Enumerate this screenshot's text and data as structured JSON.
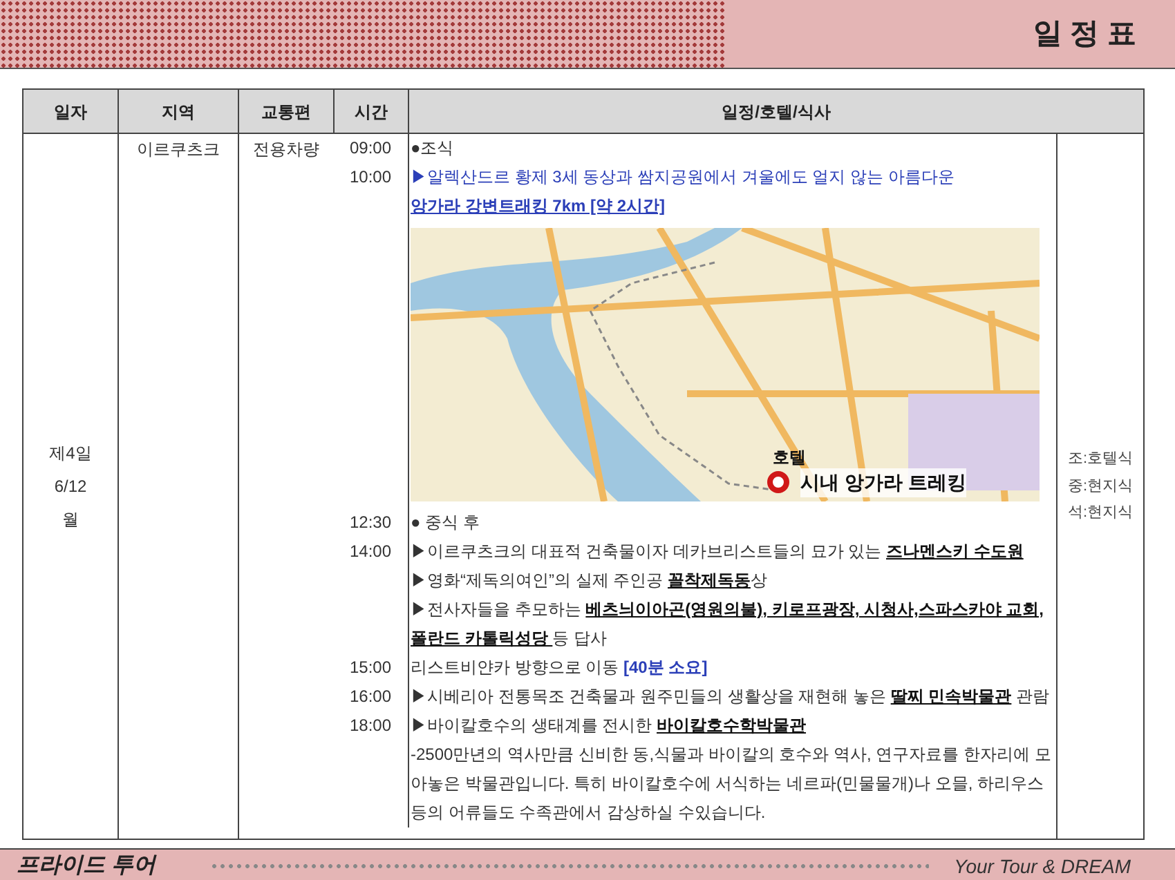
{
  "header": {
    "title": "일 정 표"
  },
  "table": {
    "columns": [
      "일자",
      "지역",
      "교통편",
      "시간",
      "일정/호텔/식사"
    ],
    "day": [
      "제4일",
      "6/12",
      "월"
    ],
    "region": "이르쿠츠크",
    "transport": "전용차량",
    "schedule": [
      {
        "kind": "text",
        "time": "09:00",
        "segments": [
          {
            "kind": "plain",
            "text": "●조식"
          }
        ]
      },
      {
        "kind": "text",
        "time": "10:00",
        "segments": [
          {
            "kind": "blue",
            "text": "▶알렉산드르 황제 3세 동상과 쌈지공원에서 겨울에도 얼지 않는 아름다운"
          }
        ]
      },
      {
        "kind": "text",
        "segments": [
          {
            "kind": "blue_link",
            "text": "앙가라 강변트래킹 7km [약 2시간]"
          }
        ]
      },
      {
        "kind": "map",
        "labels": [
          "호텔",
          "시내 앙가라 트레킹"
        ]
      },
      {
        "kind": "text",
        "time": "12:30",
        "segments": [
          {
            "kind": "plain",
            "text": "● 중식 후"
          }
        ]
      },
      {
        "kind": "text",
        "time": "14:00",
        "segments": [
          {
            "kind": "plain",
            "text": "▶이르쿠츠크의 대표적 건축물이자 데카브리스트들의 묘가 있는 "
          },
          {
            "kind": "highlight",
            "text": "즈나멘스키 수도원"
          }
        ]
      },
      {
        "kind": "text",
        "segments": [
          {
            "kind": "plain",
            "text": "▶영화“제독의여인”의 실제 주인공 "
          },
          {
            "kind": "highlight",
            "text": "꼴착제독동"
          },
          {
            "kind": "plain",
            "text": "상"
          }
        ]
      },
      {
        "kind": "text",
        "segments": [
          {
            "kind": "plain",
            "text": "▶전사자들을 추모하는 "
          },
          {
            "kind": "highlight",
            "text": "베츠늬이아곤(영원의불), 키로프광장, 시청사,스파스카야 교회, 폴란드 카톨릭성당 "
          },
          {
            "kind": "plain",
            "text": "등 답사"
          }
        ]
      },
      {
        "kind": "text",
        "time": "15:00",
        "segments": [
          {
            "kind": "plain",
            "text": "리스트비얀카 방향으로 이동 "
          },
          {
            "kind": "blue_bold",
            "text": "[40분 소요]"
          }
        ]
      },
      {
        "kind": "text",
        "time": "16:00",
        "segments": [
          {
            "kind": "plain",
            "text": "▶시베리아 전통목조 건축물과 원주민들의 생활상을 재현해 놓은 "
          },
          {
            "kind": "highlight",
            "text": "딸찌 민속박물관"
          },
          {
            "kind": "plain",
            "text": " 관람"
          }
        ]
      },
      {
        "kind": "text",
        "time": "18:00",
        "segments": [
          {
            "kind": "plain",
            "text": "▶바이칼호수의 생태계를 전시한 "
          },
          {
            "kind": "highlight",
            "text": "바이칼호수학박물관"
          }
        ]
      },
      {
        "kind": "text",
        "segments": [
          {
            "kind": "plain",
            "text": "-2500만년의 역사만큼 신비한 동,식물과 바이칼의 호수와 역사, 연구자료를 한자리에 모아놓은 박물관입니다. 특히 바이칼호수에 서식하는 네르파(민물물개)나 오믈, 하리우스등의 어류들도 수족관에서 감상하실 수있습니다."
          }
        ]
      }
    ],
    "meals": [
      "조:호텔식",
      "중:현지식",
      "석:현지식"
    ]
  },
  "footer": {
    "brand": "프라이드 투어",
    "slogan": "Your Tour & DREAM"
  }
}
